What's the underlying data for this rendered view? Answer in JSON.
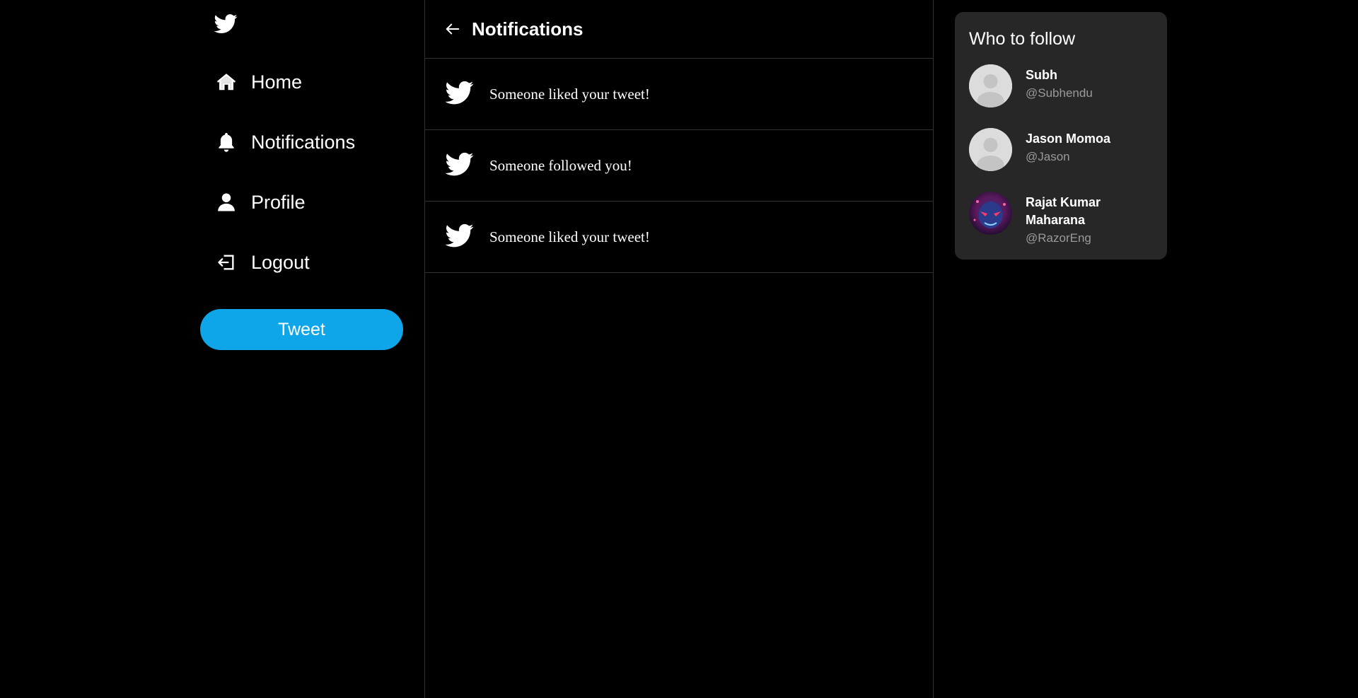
{
  "sidebar": {
    "logo_icon": "twitter-bird-icon",
    "items": [
      {
        "label": "Home",
        "icon": "home-icon"
      },
      {
        "label": "Notifications",
        "icon": "bell-icon"
      },
      {
        "label": "Profile",
        "icon": "person-icon"
      },
      {
        "label": "Logout",
        "icon": "logout-icon"
      }
    ],
    "tweet_label": "Tweet"
  },
  "main": {
    "title": "Notifications",
    "notifications": [
      {
        "text": "Someone liked your tweet!",
        "icon": "twitter-bird-icon"
      },
      {
        "text": "Someone followed you!",
        "icon": "twitter-bird-icon"
      },
      {
        "text": "Someone liked your tweet!",
        "icon": "twitter-bird-icon"
      }
    ]
  },
  "who_to_follow": {
    "title": "Who to follow",
    "users": [
      {
        "name": "Subh",
        "handle": "@Subhendu",
        "avatar": "default-avatar"
      },
      {
        "name": "Jason Momoa",
        "handle": "@Jason",
        "avatar": "default-avatar"
      },
      {
        "name": "Rajat Kumar Maharana",
        "handle": "@RazorEng",
        "avatar": "custom-avatar"
      }
    ]
  },
  "colors": {
    "background": "#000000",
    "accent": "#0ea5e9",
    "panel": "#272727",
    "divider": "#2f3336",
    "muted_text": "#9a9a9a"
  }
}
